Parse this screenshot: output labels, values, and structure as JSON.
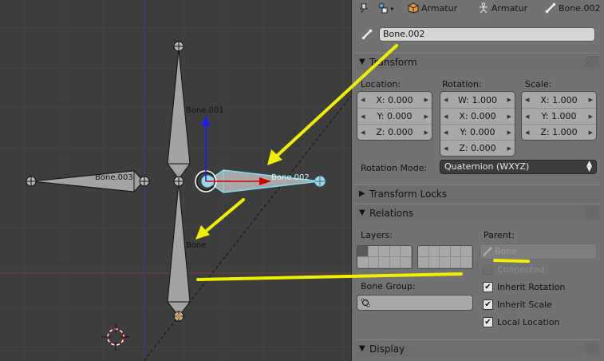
{
  "viewport": {
    "bone_labels": {
      "bone001": "Bone.001",
      "bone002": "Bone.002",
      "bone003": "Bone.003",
      "bone": "Bone"
    }
  },
  "header": {
    "crumbs": [
      {
        "label": "",
        "icon": "pin-icon"
      },
      {
        "label": "",
        "icon": "armature-data-icon"
      },
      {
        "label": "Armatur",
        "icon": "object-cube-icon"
      },
      {
        "label": "Armatur",
        "icon": "armature-figure-icon"
      },
      {
        "label": "Bone.002",
        "icon": "bone-icon"
      }
    ]
  },
  "bone_name": "Bone.002",
  "transform": {
    "title": "Transform",
    "location_label": "Location:",
    "rotation_label": "Rotation:",
    "scale_label": "Scale:",
    "location": [
      "X: 0.000",
      "Y: 0.000",
      "Z: 0.000"
    ],
    "rotation": [
      "W: 1.000",
      "X: 0.000",
      "Y: 0.000",
      "Z: 0.000"
    ],
    "scale": [
      "X: 1.000",
      "Y: 1.000",
      "Z: 1.000"
    ],
    "rotation_mode_label": "Rotation Mode:",
    "rotation_mode_value": "Quaternion (WXYZ)"
  },
  "transform_locks": {
    "title": "Transform Locks"
  },
  "relations": {
    "title": "Relations",
    "layers_label": "Layers:",
    "parent_label": "Parent:",
    "parent_value": "Bone",
    "connected_label": "Connected",
    "bone_group_label": "Bone Group:",
    "inherit_rotation_label": "Inherit Rotation",
    "inherit_scale_label": "Inherit Scale",
    "local_location_label": "Local Location",
    "connected": false,
    "inherit_rotation": true,
    "inherit_scale": true,
    "local_location": true
  },
  "display": {
    "title": "Display"
  },
  "colors": {
    "annotation": "#f2ee00",
    "selection": "#7fe0f0",
    "axis_x": "#d00000",
    "axis_z": "#1a1aff"
  }
}
